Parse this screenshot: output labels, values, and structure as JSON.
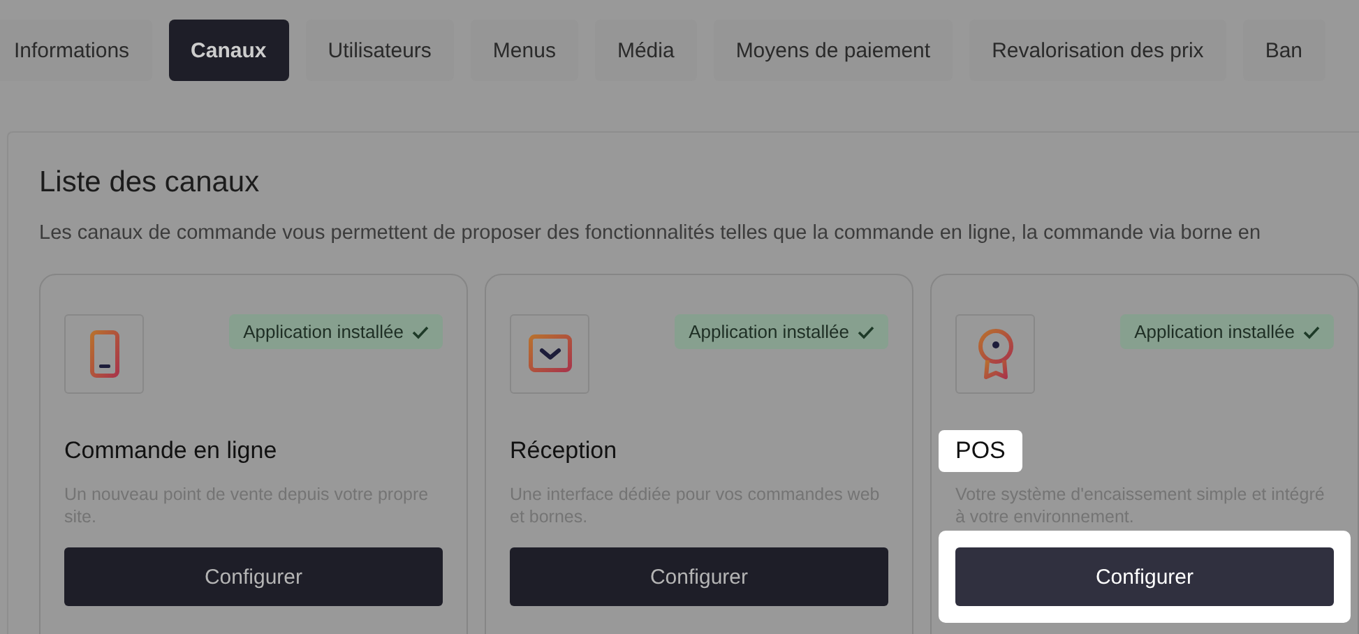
{
  "tabs": [
    {
      "label": "Informations",
      "selected": false
    },
    {
      "label": "Canaux",
      "selected": true
    },
    {
      "label": "Utilisateurs",
      "selected": false
    },
    {
      "label": "Menus",
      "selected": false
    },
    {
      "label": "Média",
      "selected": false
    },
    {
      "label": "Moyens de paiement",
      "selected": false
    },
    {
      "label": "Revalorisation des prix",
      "selected": false
    },
    {
      "label": "Ban",
      "selected": false
    }
  ],
  "panel": {
    "title": "Liste des canaux",
    "description": "Les canaux de commande vous permettent de proposer des fonctionnalités telles que la commande en ligne, la commande via borne en"
  },
  "channels": [
    {
      "kind": "phone",
      "badge": "Application installée",
      "installed": true,
      "title": "Commande en ligne",
      "description": "Un nouveau point de vente depuis votre propre site.",
      "button": "Configurer",
      "highlighted": false
    },
    {
      "kind": "screen",
      "badge": "Application installée",
      "installed": true,
      "title": "Réception",
      "description": "Une interface dédiée pour vos commandes web et bornes.",
      "button": "Configurer",
      "highlighted": false
    },
    {
      "kind": "pos",
      "badge": "Application installée",
      "installed": true,
      "title": "POS",
      "description": "Votre système d'encaissement simple et intégré à votre environnement.",
      "button": "Configurer",
      "highlighted": true
    }
  ]
}
